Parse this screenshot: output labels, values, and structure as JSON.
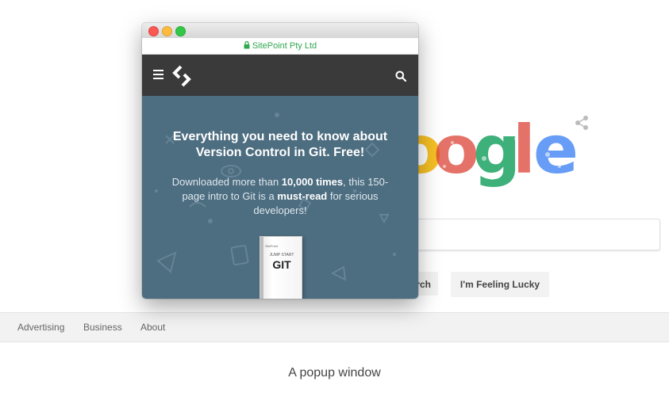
{
  "background_page": {
    "buttons": {
      "search_partial": "rch",
      "lucky": "I'm Feeling Lucky"
    },
    "footer_links": [
      "Advertising",
      "Business",
      "About"
    ],
    "icons": {
      "logo": "google-doodle-logo",
      "share": "share-icon"
    }
  },
  "popup": {
    "url_label": "SitePoint Pty Ltd",
    "icons": {
      "menu": "hamburger-menu-icon",
      "logo": "sitepoint-logo-icon",
      "search": "search-icon",
      "lock": "lock-icon"
    },
    "hero": {
      "title": "Everything you need to know about Version Control in Git. Free!",
      "desc_part1": "Downloaded more than ",
      "desc_bold1": "10,000 times",
      "desc_part2": ", this 150-page intro to Git is a ",
      "desc_bold2": "must-read",
      "desc_part3": " for serious developers!"
    },
    "book": {
      "publisher": "SitePoint",
      "series": "JUMP START",
      "title": "GIT"
    }
  },
  "caption": "A popup window",
  "colors": {
    "hero_bg": "#4d6d80",
    "navbar_bg": "#3a3a3a",
    "secure_green": "#2fa84f"
  }
}
